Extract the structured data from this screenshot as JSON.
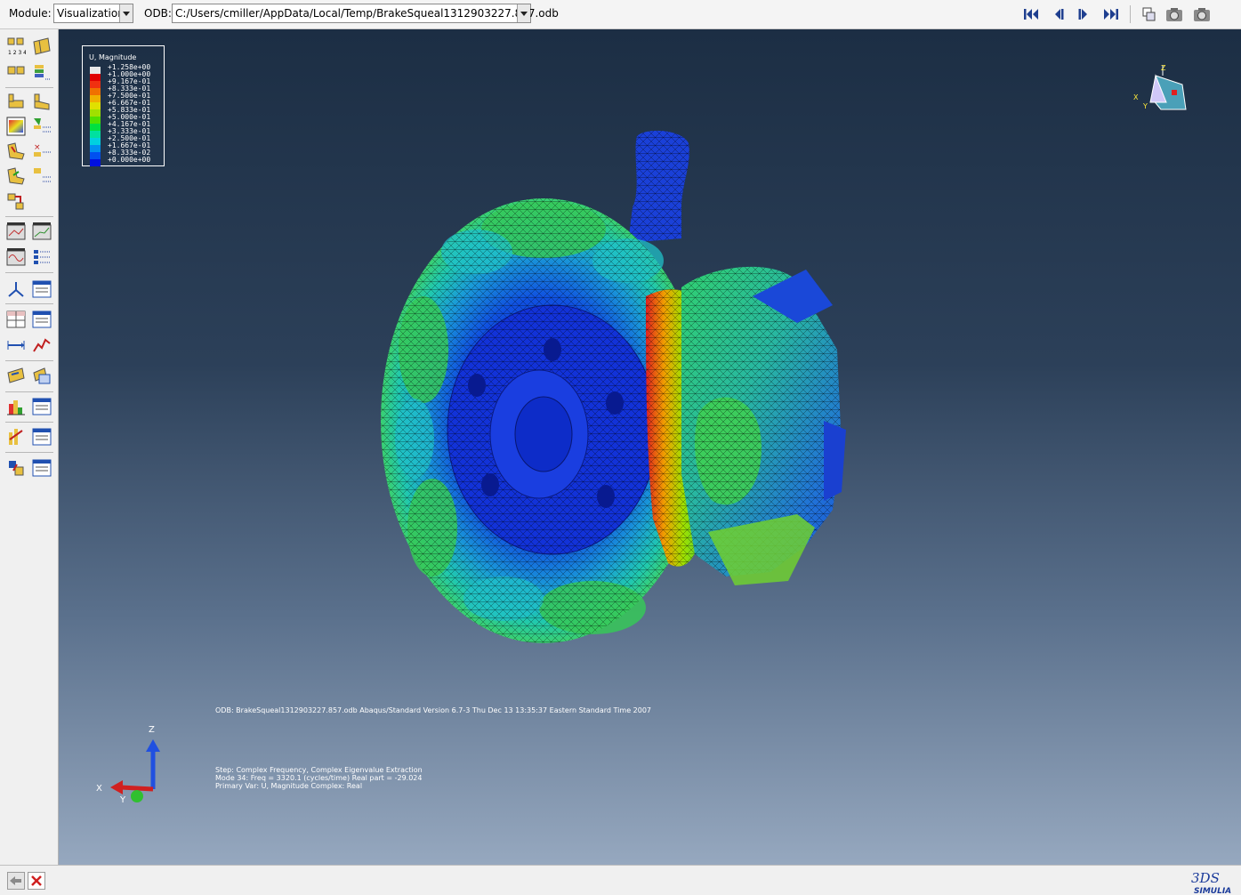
{
  "toolbar": {
    "module_label": "Module:",
    "module_value": "Visualization",
    "odb_label": "ODB:",
    "odb_value": "C:/Users/cmiller/AppData/Local/Temp/BrakeSqueal1312903227.857.odb"
  },
  "legend": {
    "title": "U, Magnitude",
    "entries": [
      {
        "value": "+1.258e+00",
        "color": "#e8e8e8"
      },
      {
        "value": "+1.000e+00",
        "color": "#e00000"
      },
      {
        "value": "+9.167e-01",
        "color": "#f03010"
      },
      {
        "value": "+8.333e-01",
        "color": "#f07000"
      },
      {
        "value": "+7.500e-01",
        "color": "#f0b000"
      },
      {
        "value": "+6.667e-01",
        "color": "#e0e000"
      },
      {
        "value": "+5.833e-01",
        "color": "#a0e000"
      },
      {
        "value": "+5.000e-01",
        "color": "#50e000"
      },
      {
        "value": "+4.167e-01",
        "color": "#00e040"
      },
      {
        "value": "+3.333e-01",
        "color": "#00e0a0"
      },
      {
        "value": "+2.500e-01",
        "color": "#00d0e0"
      },
      {
        "value": "+1.667e-01",
        "color": "#0090f0"
      },
      {
        "value": "+8.333e-02",
        "color": "#0050f0"
      },
      {
        "value": "+0.000e+00",
        "color": "#0010e0"
      }
    ]
  },
  "viewport": {
    "odb_info": "ODB: BrakeSqueal1312903227.857.odb    Abaqus/Standard Version 6.7-3    Thu Dec 13 13:35:37 Eastern Standard Time 2007",
    "step_line": "Step: Complex Frequency, Complex Eigenvalue Extraction",
    "mode_line": "Mode        34: Freq =   3320.1      (cycles/time) Real part = -29.024",
    "var_line": "Primary Var: U, Magnitude   Complex: Real"
  },
  "triad": {
    "x": "X",
    "y": "Y",
    "z": "Z"
  },
  "mini_triad": {
    "x": "X",
    "y": "Y",
    "z": "Z"
  },
  "brand": "SIMULIA",
  "brand_mark": "3DS"
}
